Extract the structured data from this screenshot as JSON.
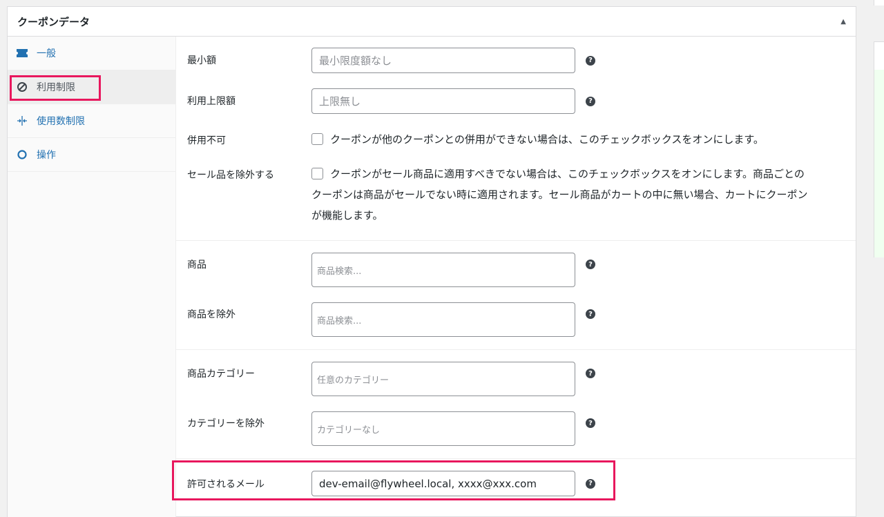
{
  "panel": {
    "title": "クーポンデータ"
  },
  "tabs": [
    {
      "label": "一般",
      "icon": "ticket-icon"
    },
    {
      "label": "利用制限",
      "icon": "no-entry-icon"
    },
    {
      "label": "使用数制限",
      "icon": "arrows-in-icon"
    },
    {
      "label": "操作",
      "icon": "gear-icon"
    }
  ],
  "fields": {
    "min_amount": {
      "label": "最小額",
      "placeholder": "最小限度額なし"
    },
    "max_amount": {
      "label": "利用上限額",
      "placeholder": "上限無し"
    },
    "individual_use": {
      "label": "併用不可",
      "text": "クーポンが他のクーポンとの併用ができない場合は、このチェックボックスをオンにします。"
    },
    "exclude_sale": {
      "label": "セール品を除外する",
      "line1": "クーポンがセール商品に適用すべきでない場合は、このチェックボックスをオンにします。商品ごとの",
      "line2": "クーポンは商品がセールでない時に適用されます。セール商品がカートの中に無い場合、カートにクーポン",
      "line3": "が機能します。"
    },
    "products": {
      "label": "商品",
      "placeholder": "商品検索..."
    },
    "exclude_products": {
      "label": "商品を除外",
      "placeholder": "商品検索..."
    },
    "product_categories": {
      "label": "商品カテゴリー",
      "placeholder": "任意のカテゴリー"
    },
    "exclude_categories": {
      "label": "カテゴリーを除外",
      "placeholder": "カテゴリーなし"
    },
    "allowed_emails": {
      "label": "許可されるメール",
      "value": "dev-email@flywheel.local, xxxx@xxx.com"
    }
  },
  "colors": {
    "accent": "#2271b1",
    "highlight": "#e8175d"
  }
}
